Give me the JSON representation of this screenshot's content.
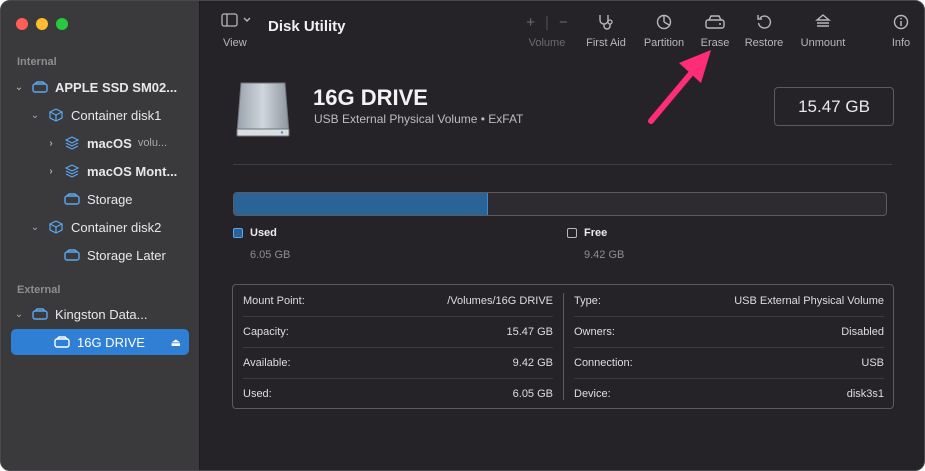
{
  "window": {
    "traffic_lights": {
      "close": "#ff5f57",
      "minimize": "#febc2e",
      "zoom": "#28c840"
    }
  },
  "sidebar": {
    "internal_label": "Internal",
    "external_label": "External",
    "items": [
      {
        "label": "APPLE SSD SM02...",
        "sub": ""
      },
      {
        "label": "Container disk1",
        "sub": ""
      },
      {
        "label": "macOS",
        "sub": "volu..."
      },
      {
        "label": "macOS Mont...",
        "sub": ""
      },
      {
        "label": "Storage",
        "sub": ""
      },
      {
        "label": "Container disk2",
        "sub": ""
      },
      {
        "label": "Storage Later",
        "sub": ""
      },
      {
        "label": "Kingston Data...",
        "sub": ""
      },
      {
        "label": "16G DRIVE",
        "sub": ""
      }
    ],
    "eject_symbol": "⏏"
  },
  "toolbar": {
    "view_label": "View",
    "title": "Disk Utility",
    "volume_label": "Volume",
    "first_aid_label": "First Aid",
    "partition_label": "Partition",
    "erase_label": "Erase",
    "restore_label": "Restore",
    "unmount_label": "Unmount",
    "info_label": "Info"
  },
  "drive": {
    "name": "16G DRIVE",
    "subtitle": "USB External Physical Volume • ExFAT",
    "size": "15.47 GB"
  },
  "usage": {
    "used_fraction": 0.39,
    "used_label": "Used",
    "used_value": "6.05 GB",
    "free_label": "Free",
    "free_value": "9.42 GB",
    "used_color": "#2a6496"
  },
  "info": {
    "left": [
      {
        "key": "Mount Point:",
        "value": "/Volumes/16G DRIVE"
      },
      {
        "key": "Capacity:",
        "value": "15.47 GB"
      },
      {
        "key": "Available:",
        "value": "9.42 GB"
      },
      {
        "key": "Used:",
        "value": "6.05 GB"
      }
    ],
    "right": [
      {
        "key": "Type:",
        "value": "USB External Physical Volume"
      },
      {
        "key": "Owners:",
        "value": "Disabled"
      },
      {
        "key": "Connection:",
        "value": "USB"
      },
      {
        "key": "Device:",
        "value": "disk3s1"
      }
    ]
  },
  "annotation": {
    "color": "#ff2d78",
    "points_to": "erase-button"
  }
}
